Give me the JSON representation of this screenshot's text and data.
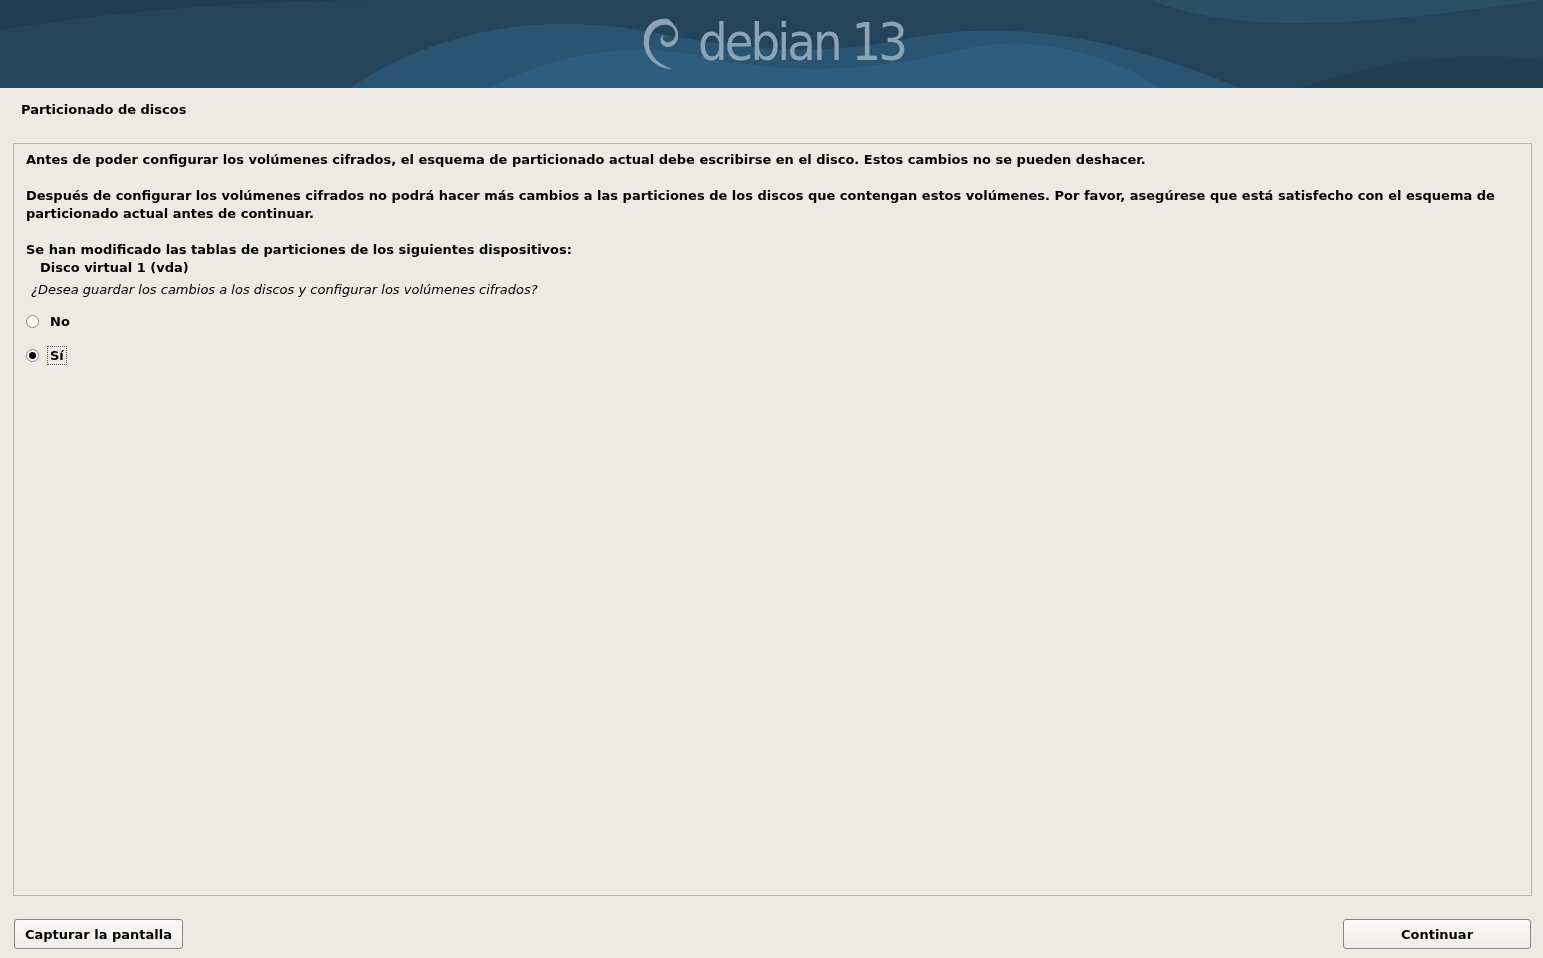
{
  "header": {
    "logo_text": "debian 13"
  },
  "title": "Particionado de discos",
  "paragraphs": [
    "Antes de poder configurar los volúmenes cifrados, el esquema de particionado actual debe escribirse en el disco.  Estos cambios no se pueden deshacer.",
    "Después de configurar los volúmenes cifrados no podrá hacer más cambios a las particiones de los discos que contengan estos volúmenes. Por favor, asegúrese que está satisfecho con el esquema de particionado actual antes de continuar."
  ],
  "devices_heading": "Se han modificado las tablas de particiones de los siguientes dispositivos:",
  "devices": [
    "Disco virtual 1 (vda)"
  ],
  "question": "¿Desea guardar los cambios a los discos y configurar los volúmenes cifrados?",
  "options": [
    {
      "label": "No",
      "selected": false
    },
    {
      "label": "Sí",
      "selected": true
    }
  ],
  "buttons": [
    {
      "label": "Capturar la pantalla",
      "kind": "left"
    },
    {
      "label": "Continuar",
      "kind": "right"
    }
  ]
}
